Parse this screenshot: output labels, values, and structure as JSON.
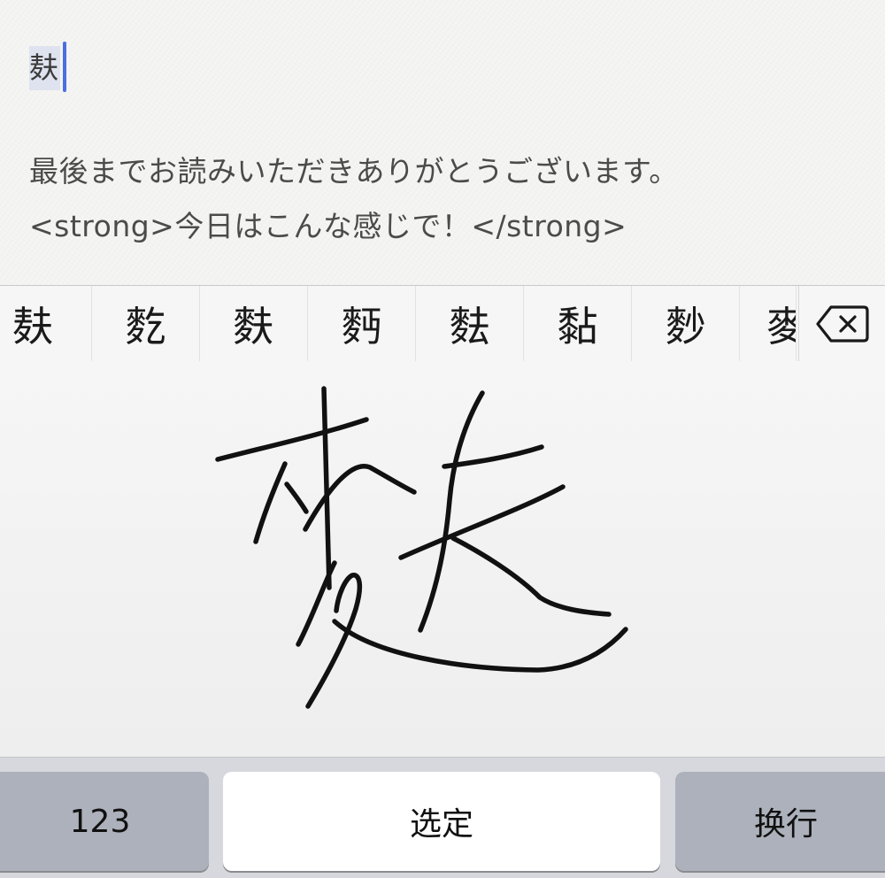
{
  "editor": {
    "composing_text": "麸",
    "line1": "最後までお読みいただきありがとうございます。",
    "line2": "<strong>今日はこんな感じで！</strong>"
  },
  "candidates": [
    {
      "label": "麸"
    },
    {
      "label": "麧"
    },
    {
      "label": "麩"
    },
    {
      "label": "麪"
    },
    {
      "label": "麮"
    },
    {
      "label": "黏"
    },
    {
      "label": "麨"
    },
    {
      "label": "麥"
    }
  ],
  "keys": {
    "numbers_label": "123",
    "select_label": "选定",
    "enter_label": "换行"
  },
  "icons": {
    "backspace": "backspace-icon"
  },
  "colors": {
    "caret": "#4a6fe0",
    "composing_highlight": "#dfe3ef",
    "function_key": "#acb1bb",
    "keyboard_background": "#d6d8dd"
  }
}
